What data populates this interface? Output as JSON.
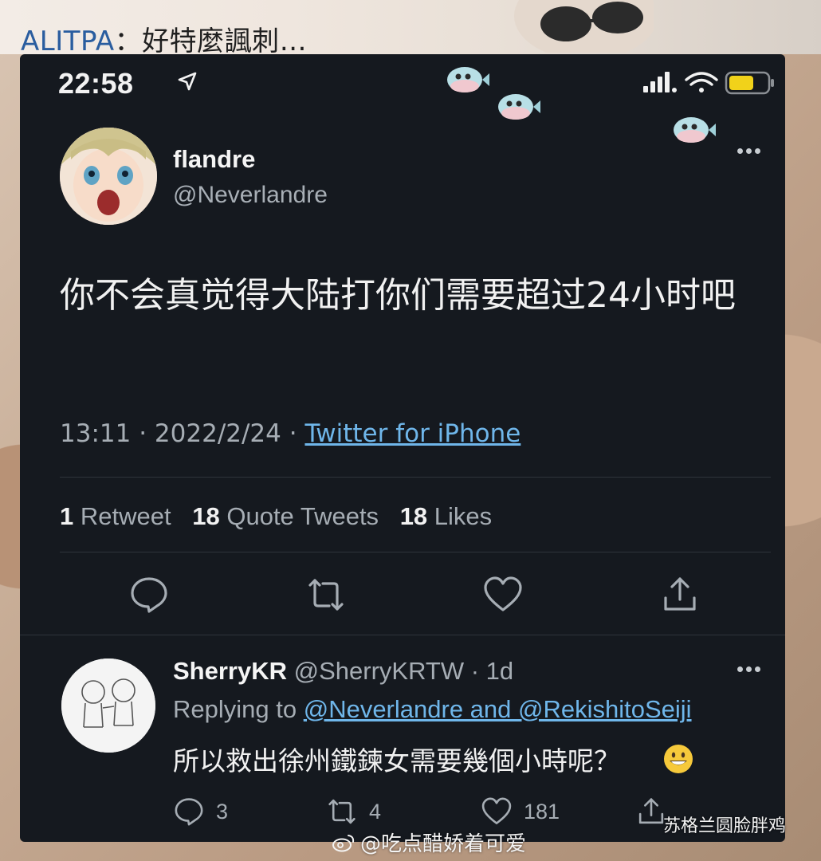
{
  "caption": {
    "source": "ALITPA",
    "separator": "：",
    "text": "好特麼諷刺…"
  },
  "status_bar": {
    "time": "22:58",
    "battery_color": "#f1d21a"
  },
  "tweet": {
    "author_name": "flandre",
    "author_handle": "@Neverlandre",
    "text": "你不会真觉得大陆打你们需要超过24小时吧",
    "time": "13:11",
    "date": "2022/2/24",
    "client": "Twitter for iPhone",
    "stats": {
      "retweets_count": "1",
      "retweets_label": "Retweet",
      "quotes_count": "18",
      "quotes_label": "Quote Tweets",
      "likes_count": "18",
      "likes_label": "Likes"
    }
  },
  "reply": {
    "author_name": "SherryKR",
    "author_handle": "@SherryKRTW",
    "age": "1d",
    "replying_prefix": "Replying to",
    "replying_to": "@Neverlandre and @RekishitoSeiji",
    "text": "所以救出徐州鐵鍊女需要幾個小時呢？",
    "reply_count": "3",
    "retweet_count": "4",
    "like_count": "181"
  },
  "watermarks": {
    "center": "@吃点醋娇着可爱",
    "right": "苏格兰圆脸胖鸡"
  },
  "colors": {
    "panel_bg": "#15191f",
    "link": "#6fb6ea",
    "muted": "#a6adb4"
  }
}
